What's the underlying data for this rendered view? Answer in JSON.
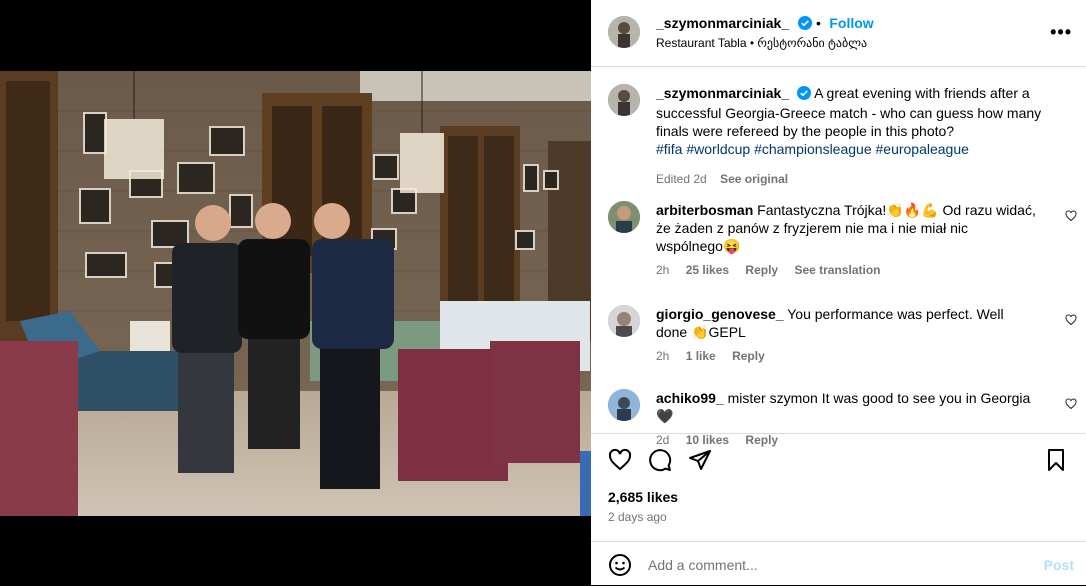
{
  "post": {
    "username": "_szymonmarciniak_",
    "follow_label": "Follow",
    "location": "Restaurant Tabla • რესტორანი ტაბლა",
    "caption_text": "A great evening with friends after a successful Georgia-Greece match - who can guess how many finals were refereed by the people in this photo?",
    "hashtags": [
      "#fifa",
      "#worldcup",
      "#championsleague",
      "#europaleague"
    ],
    "edited_label": "Edited",
    "caption_age": "2d",
    "see_original": "See original",
    "likes": "2,685 likes",
    "posted_ago": "2 days ago"
  },
  "comments": [
    {
      "username": "arbiterbosman",
      "text": "Fantastyczna Trójka!👏🔥💪 Od razu widać, że żaden z panów z fryzjerem nie ma i nie miał nic wspólnego😝",
      "age": "2h",
      "likes": "25 likes",
      "reply": "Reply",
      "translate": "See translation"
    },
    {
      "username": "giorgio_genovese_",
      "text": "You performance was perfect. Well done 👏GEPL",
      "age": "2h",
      "likes": "1 like",
      "reply": "Reply"
    },
    {
      "username": "achiko99_",
      "text": "mister szymon It was good to see you in Georgia 🖤",
      "age": "2d",
      "likes": "10 likes",
      "reply": "Reply"
    }
  ],
  "add_comment": {
    "placeholder": "Add a comment...",
    "post_label": "Post"
  },
  "colors": {
    "link": "#0095f6",
    "hashtag": "#00376b",
    "muted": "#737373",
    "divider": "#dbdbdb"
  },
  "icons": [
    "heart-icon",
    "comment-icon",
    "share-icon",
    "bookmark-icon",
    "more-icon",
    "emoji-icon",
    "verified-badge-icon"
  ]
}
